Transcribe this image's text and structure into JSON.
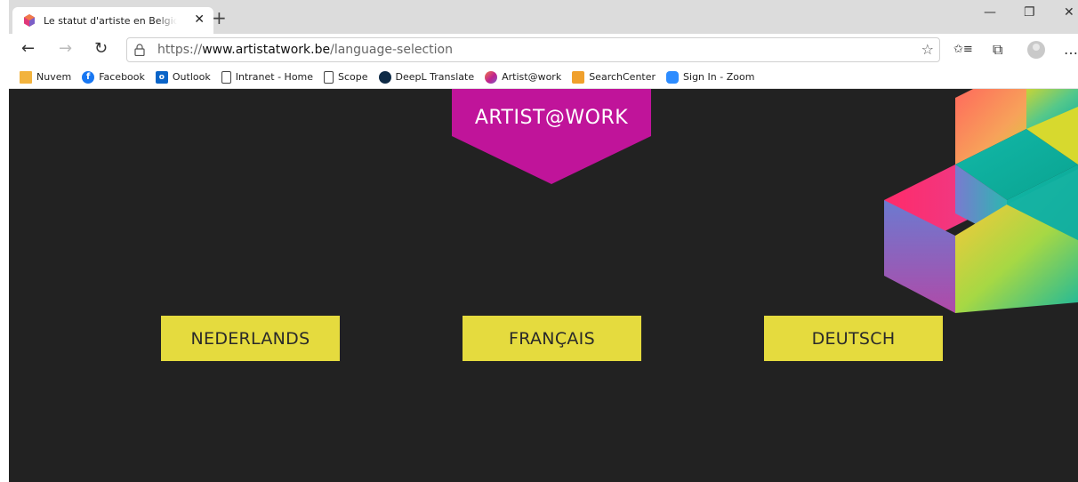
{
  "browser": {
    "tab": {
      "title": "Le statut d'artiste en Belgique | A",
      "close": "✕"
    },
    "new_tab": "+",
    "window_controls": {
      "minimize": "—",
      "restore": "❐",
      "close": "✕"
    },
    "nav": {
      "back": "←",
      "forward": "→",
      "refresh": "↻"
    },
    "url": {
      "scheme": "https://",
      "host": "www.artistatwork.be",
      "path": "/language-selection"
    },
    "toolbar": {
      "favorite": "☆",
      "favorites_list": "✩≡",
      "collections": "⧉",
      "more": "…"
    },
    "bookmarks": [
      {
        "label": "Nuvem",
        "icon": "folder-icon",
        "color": "#f2b33d"
      },
      {
        "label": "Facebook",
        "icon": "facebook-icon",
        "color": "#1877f2"
      },
      {
        "label": "Outlook",
        "icon": "outlook-icon",
        "color": "#0a64c8"
      },
      {
        "label": "Intranet - Home",
        "icon": "page-icon",
        "color": "#ffffff"
      },
      {
        "label": "Scope",
        "icon": "page-icon",
        "color": "#ffffff"
      },
      {
        "label": "DeepL Translate",
        "icon": "deepl-icon",
        "color": "#0f2b46"
      },
      {
        "label": "Artist@work",
        "icon": "artistatwork-icon",
        "color": "#c0228f"
      },
      {
        "label": "SearchCenter",
        "icon": "searchcenter-icon",
        "color": "#f0a02c"
      },
      {
        "label": "Sign In - Zoom",
        "icon": "zoom-icon",
        "color": "#2d8cff"
      }
    ]
  },
  "page": {
    "logo_text": "ARTIST@WORK",
    "colors": {
      "background": "#222222",
      "accent": "#c0149a",
      "button": "#e5db3e"
    },
    "languages": [
      {
        "label": "NEDERLANDS"
      },
      {
        "label": "FRANÇAIS"
      },
      {
        "label": "DEUTSCH"
      }
    ]
  }
}
